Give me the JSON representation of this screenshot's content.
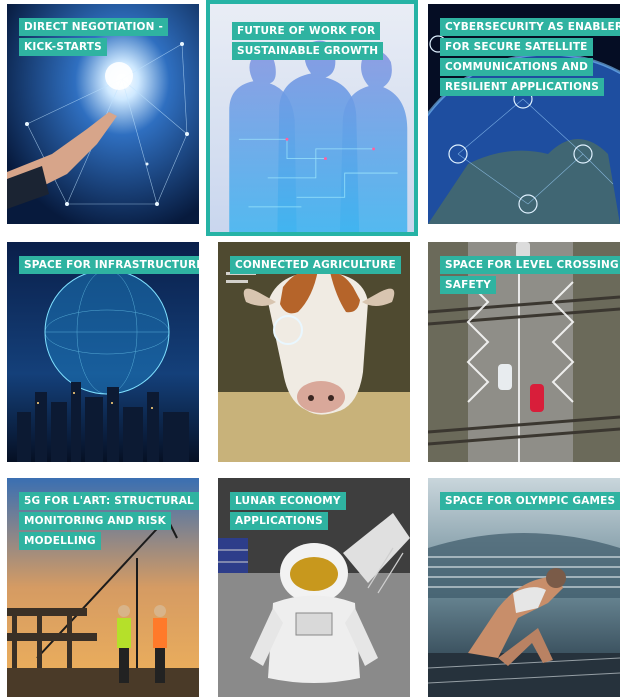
{
  "tiles": [
    {
      "id": "direct-negotiation",
      "lines": [
        "DIRECT NEGOTIATION -",
        "KICK-STARTS"
      ],
      "selected": false
    },
    {
      "id": "future-of-work",
      "lines": [
        "FUTURE OF WORK FOR",
        "SUSTAINABLE GROWTH"
      ],
      "selected": true
    },
    {
      "id": "cybersecurity",
      "lines": [
        "CYBERSECURITY AS ENABLER",
        "FOR SECURE SATELLITE",
        "COMMUNICATIONS AND",
        "RESILIENT APPLICATIONS"
      ],
      "selected": false
    },
    {
      "id": "space-infrastructure",
      "lines": [
        "SPACE FOR INFRASTRUCTURE"
      ],
      "selected": false
    },
    {
      "id": "connected-agriculture",
      "lines": [
        "CONNECTED AGRICULTURE"
      ],
      "selected": false
    },
    {
      "id": "level-crossing",
      "lines": [
        "SPACE FOR LEVEL CROSSING",
        "SAFETY"
      ],
      "selected": false
    },
    {
      "id": "5g-art",
      "lines": [
        "5G FOR L'ART: STRUCTURAL",
        "MONITORING AND RISK",
        "MODELLING"
      ],
      "selected": false
    },
    {
      "id": "lunar-economy",
      "lines": [
        "LUNAR ECONOMY",
        "APPLICATIONS"
      ],
      "selected": false
    },
    {
      "id": "olympic-games",
      "lines": [
        "SPACE FOR OLYMPIC GAMES"
      ],
      "selected": false
    }
  ],
  "colors": {
    "label_bg": "#2fb3a1",
    "selected_border": "#26b3a5"
  }
}
